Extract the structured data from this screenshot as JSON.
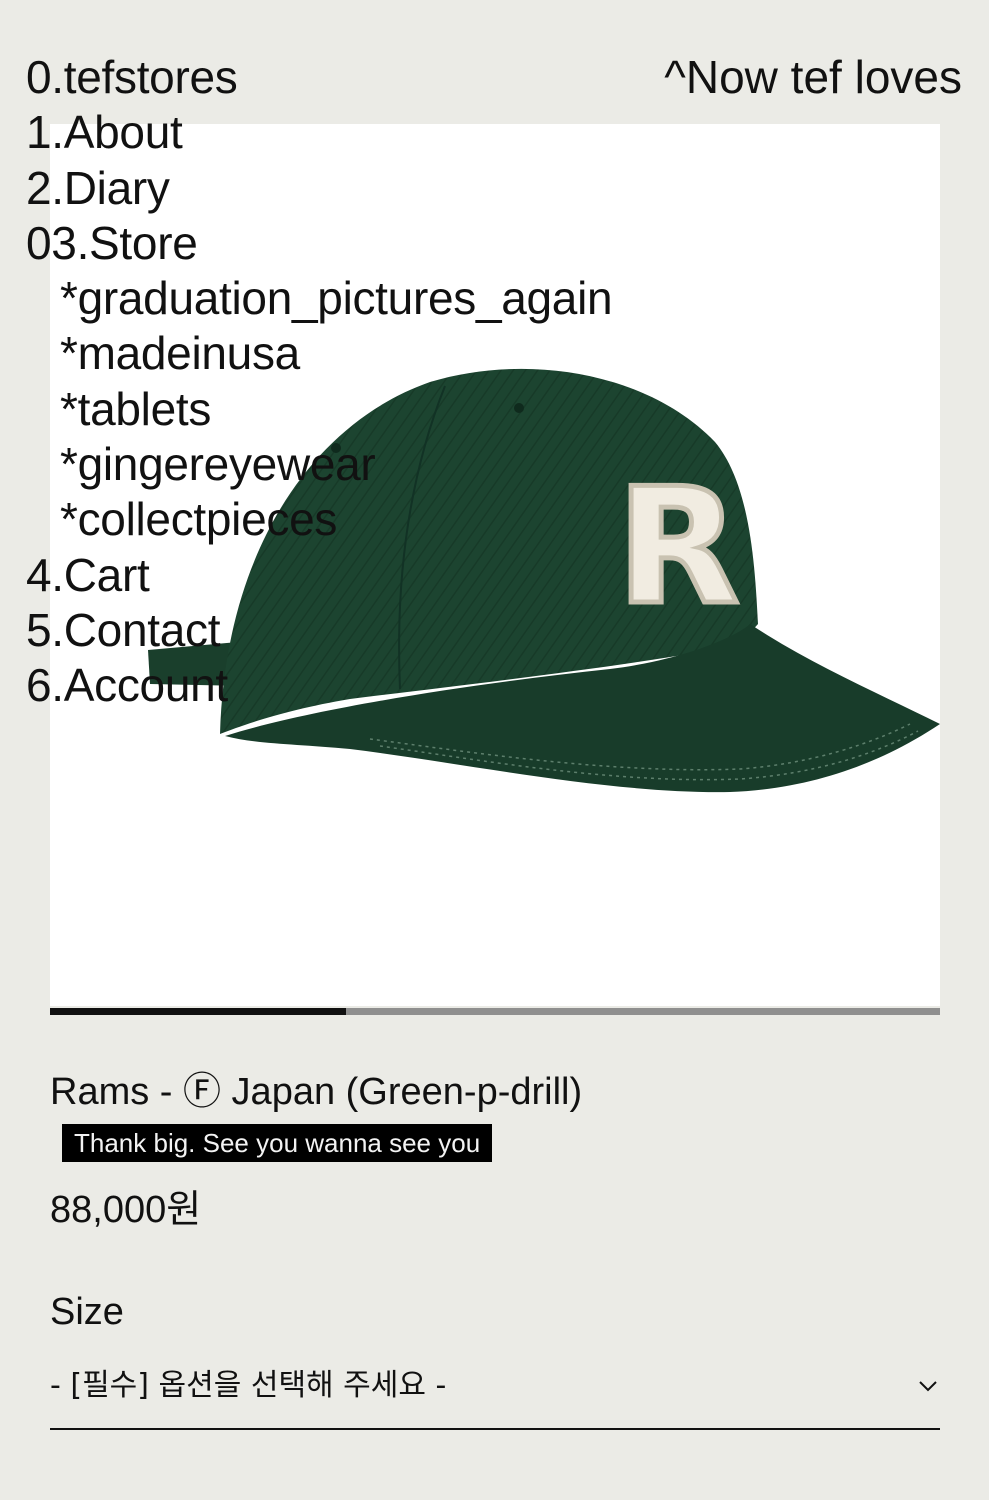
{
  "nav": {
    "home": "0.tefstores",
    "about": "1.About",
    "diary": "2.Diary",
    "store": "03.Store",
    "store_categories": [
      "*graduation_pictures_again",
      "*madeinusa",
      "*tablets",
      "*gingereyewear",
      "*collectpieces"
    ],
    "cart": "4.Cart",
    "contact": "5.Contact",
    "account": "6.Account"
  },
  "now_loves": "^Now tef loves",
  "product": {
    "name": "Rams - Ⓕ Japan (Green-p-drill)",
    "summary": "Thank big. See you wanna see you",
    "price": "88,000원",
    "image_logo_letter": "R",
    "image_slider_progress": 0.333,
    "option": {
      "label": "Size",
      "selected": "- [필수] 옵션을 선택해 주세요 -"
    }
  },
  "colors": {
    "background": "#ebebe6",
    "cap_green": "#1c4430",
    "text": "#111111"
  },
  "icons": {
    "select": "chevron-down-icon"
  }
}
